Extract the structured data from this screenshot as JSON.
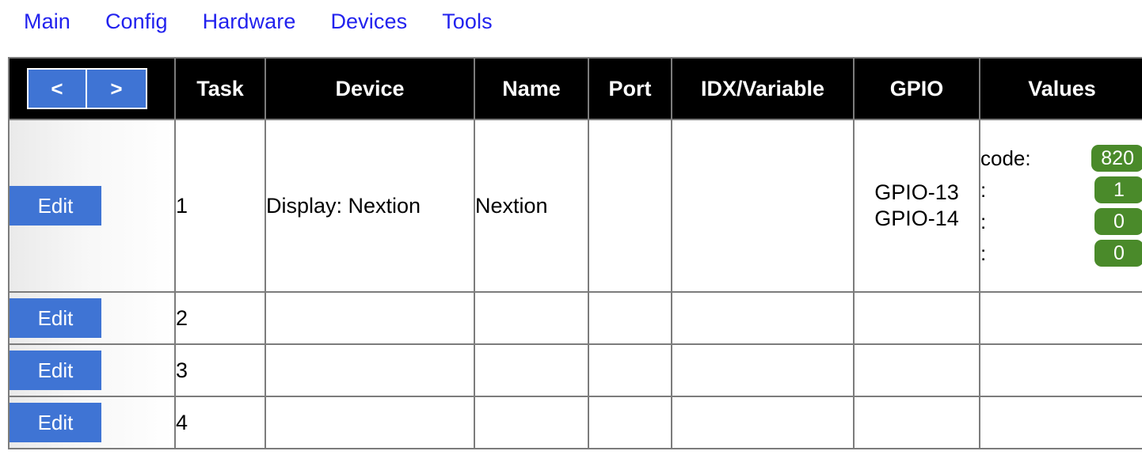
{
  "nav": {
    "links": [
      {
        "label": "Main"
      },
      {
        "label": "Config"
      },
      {
        "label": "Hardware"
      },
      {
        "label": "Devices"
      },
      {
        "label": "Tools"
      }
    ],
    "link_color": "#2222ee"
  },
  "colors": {
    "button_blue": "#3f74d4",
    "badge_green": "#4a8a2a",
    "header_background": "#000000",
    "header_text": "#ffffff",
    "border": "#7c7c7c"
  },
  "table": {
    "pager": {
      "prev_label": "<",
      "next_label": ">"
    },
    "headers": {
      "nav": "",
      "task": "Task",
      "device": "Device",
      "name": "Name",
      "port": "Port",
      "idx_variable": "IDX/Variable",
      "gpio": "GPIO",
      "values": "Values"
    },
    "rows": [
      {
        "edit_label": "Edit",
        "task": "1",
        "device": "Display: Nextion",
        "name": "Nextion",
        "port": "",
        "idx_variable": "",
        "gpio_lines": [
          "GPIO-13",
          "GPIO-14"
        ],
        "values": [
          {
            "label": "code:",
            "value": "820"
          },
          {
            "label": ":",
            "value": "1"
          },
          {
            "label": ":",
            "value": "0"
          },
          {
            "label": ":",
            "value": "0"
          }
        ]
      },
      {
        "edit_label": "Edit",
        "task": "2",
        "device": "",
        "name": "",
        "port": "",
        "idx_variable": "",
        "gpio_lines": [],
        "values": []
      },
      {
        "edit_label": "Edit",
        "task": "3",
        "device": "",
        "name": "",
        "port": "",
        "idx_variable": "",
        "gpio_lines": [],
        "values": []
      },
      {
        "edit_label": "Edit",
        "task": "4",
        "device": "",
        "name": "",
        "port": "",
        "idx_variable": "",
        "gpio_lines": [],
        "values": []
      }
    ]
  }
}
